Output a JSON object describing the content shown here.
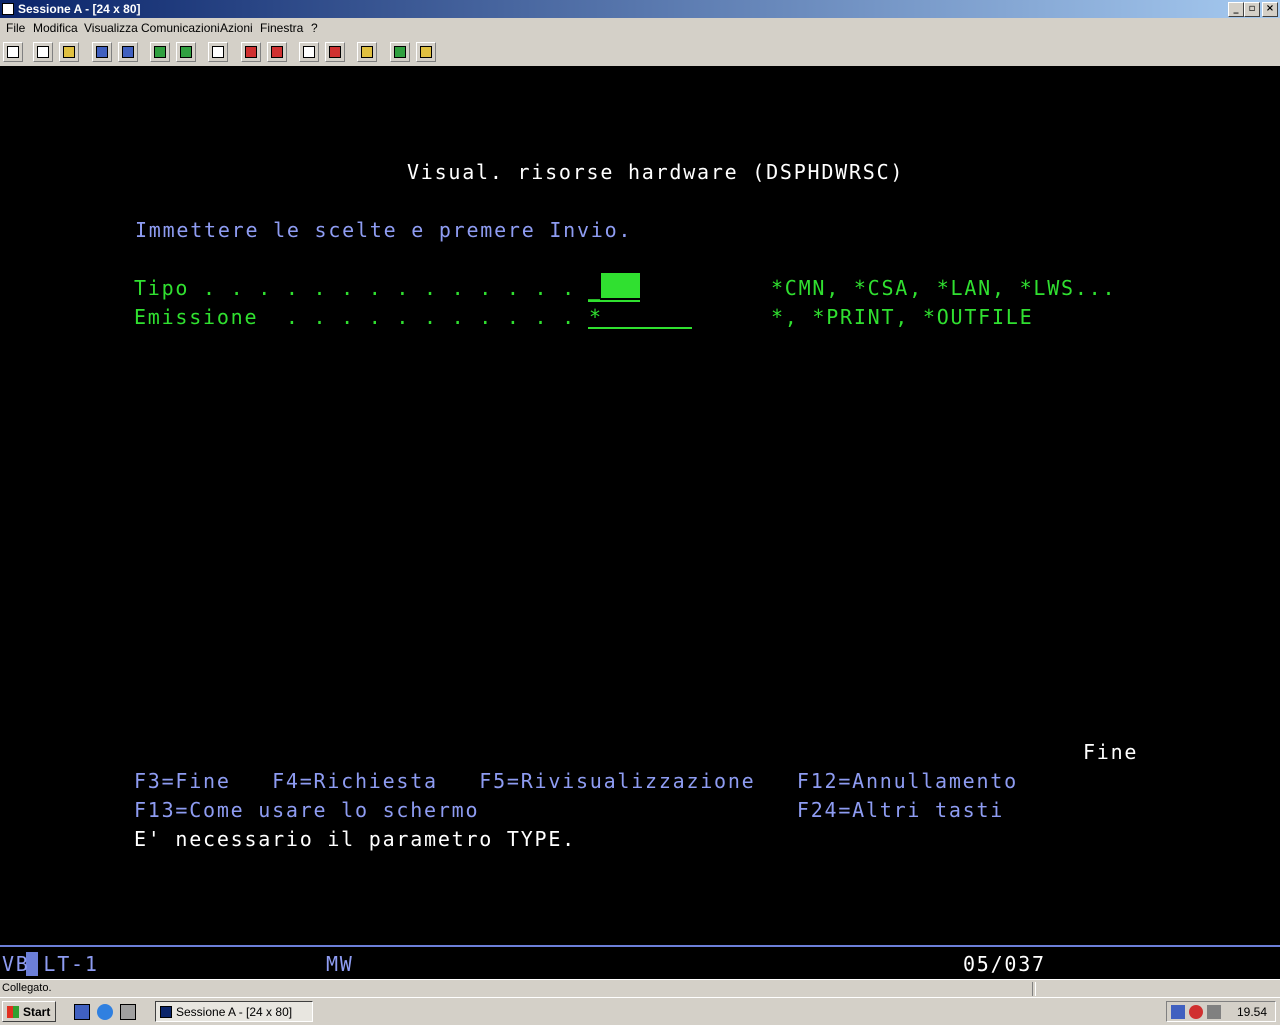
{
  "window": {
    "title": "Sessione A - [24 x 80]"
  },
  "menu": [
    "File",
    "Modifica",
    "Visualizza",
    "Comunicazioni",
    "Azioni",
    "Finestra",
    "?"
  ],
  "screen": {
    "title": "Visual. risorse hardware (DSPHDWRSC)",
    "instruction": "Immettere le scelte e premere Invio.",
    "fields": [
      {
        "label": "Tipo . . . . . . . . . . . . . .",
        "value": "_",
        "hint": "*CMN, *CSA, *LAN, *LWS..."
      },
      {
        "label": "Emissione  . . . . . . . . . . .",
        "value": "*",
        "hint": "*, *PRINT, *OUTFILE"
      }
    ],
    "more": "Fine",
    "fkeys_line1": "F3=Fine   F4=Richiesta   F5=Rivisualizzazione   F12=Annullamento",
    "fkeys_line2": "F13=Come usare lo schermo                       F24=Altri tasti",
    "message": "E' necessario il parametro TYPE."
  },
  "oia": {
    "left": "VB LT-1",
    "mode": "MW",
    "position": "05/037"
  },
  "status": {
    "text": "Collegato."
  },
  "taskbar": {
    "start": "Start",
    "task": "Sessione A - [24 x 80]",
    "clock": "19.54"
  }
}
